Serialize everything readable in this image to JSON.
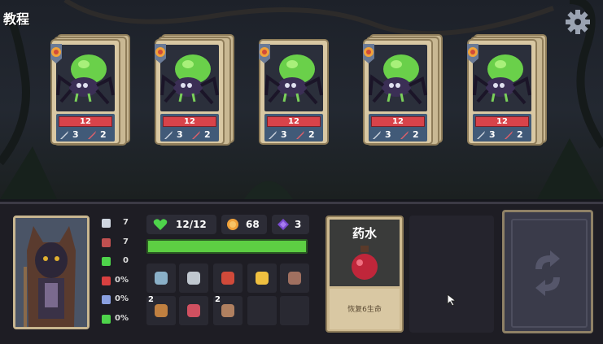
{
  "header": {
    "title": "教程"
  },
  "enemies": [
    {
      "hp": "12",
      "attack": "3",
      "defense": "2"
    },
    {
      "hp": "12",
      "attack": "3",
      "defense": "2"
    },
    {
      "hp": "12",
      "attack": "3",
      "defense": "2"
    },
    {
      "hp": "12",
      "attack": "3",
      "defense": "2"
    },
    {
      "hp": "12",
      "attack": "3",
      "defense": "2"
    }
  ],
  "player": {
    "stats": [
      {
        "icon": "sword-icon",
        "value": "7"
      },
      {
        "icon": "shield-icon",
        "value": "7"
      },
      {
        "icon": "clover-icon",
        "value": "0"
      },
      {
        "icon": "grid-icon",
        "value": "0%"
      },
      {
        "icon": "feather-icon",
        "value": "0%"
      },
      {
        "icon": "plus-circle-icon",
        "value": "0%"
      }
    ],
    "hp": "12/12",
    "hp_fraction": 1.0,
    "gold": "68",
    "gems": "3"
  },
  "inventory": [
    {
      "icon": "scroll-pouch-icon",
      "count": ""
    },
    {
      "icon": "dagger-icon",
      "count": ""
    },
    {
      "icon": "helmet-icon",
      "count": ""
    },
    {
      "icon": "flask-icon",
      "count": ""
    },
    {
      "icon": "round-shield-icon",
      "count": ""
    },
    {
      "icon": "club-icon",
      "count": "2"
    },
    {
      "icon": "spear-icon",
      "count": ""
    },
    {
      "icon": "chain-icon",
      "count": "2"
    }
  ],
  "potion_card": {
    "title": "药水",
    "description": "恢复6生命"
  },
  "colors": {
    "hp_red": "#d8434a",
    "hp_green": "#5dcf43",
    "card_frame": "#d9c8a3",
    "stat_blue": "#415a78"
  }
}
